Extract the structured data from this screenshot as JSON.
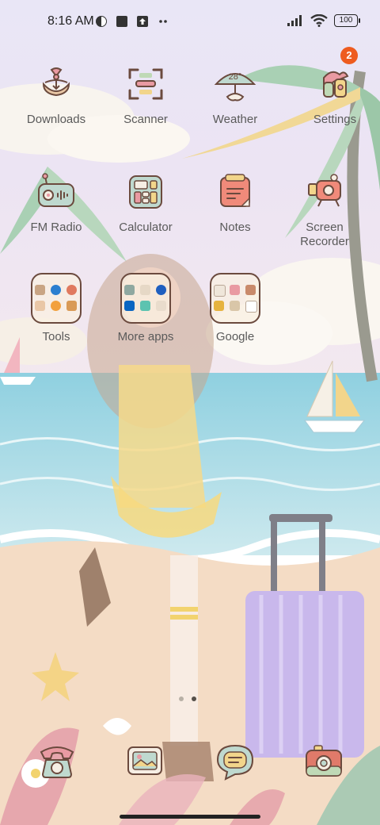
{
  "status_bar": {
    "time": "8:16 AM",
    "battery": "100"
  },
  "apps": {
    "downloads": "Downloads",
    "scanner": "Scanner",
    "weather": "Weather",
    "weather_temp": "28°",
    "settings": "Settings",
    "settings_badge": "2",
    "fm_radio": "FM Radio",
    "calculator": "Calculator",
    "notes": "Notes",
    "screen_recorder_line1": "Screen",
    "screen_recorder_line2": "Recorder"
  },
  "folders": {
    "tools": "Tools",
    "more_apps": "More apps",
    "google": "Google"
  },
  "page_indicator": {
    "pages": 2,
    "current": 2
  },
  "dock": [
    "phone-icon",
    "gallery-icon",
    "messages-icon",
    "camera-icon"
  ]
}
